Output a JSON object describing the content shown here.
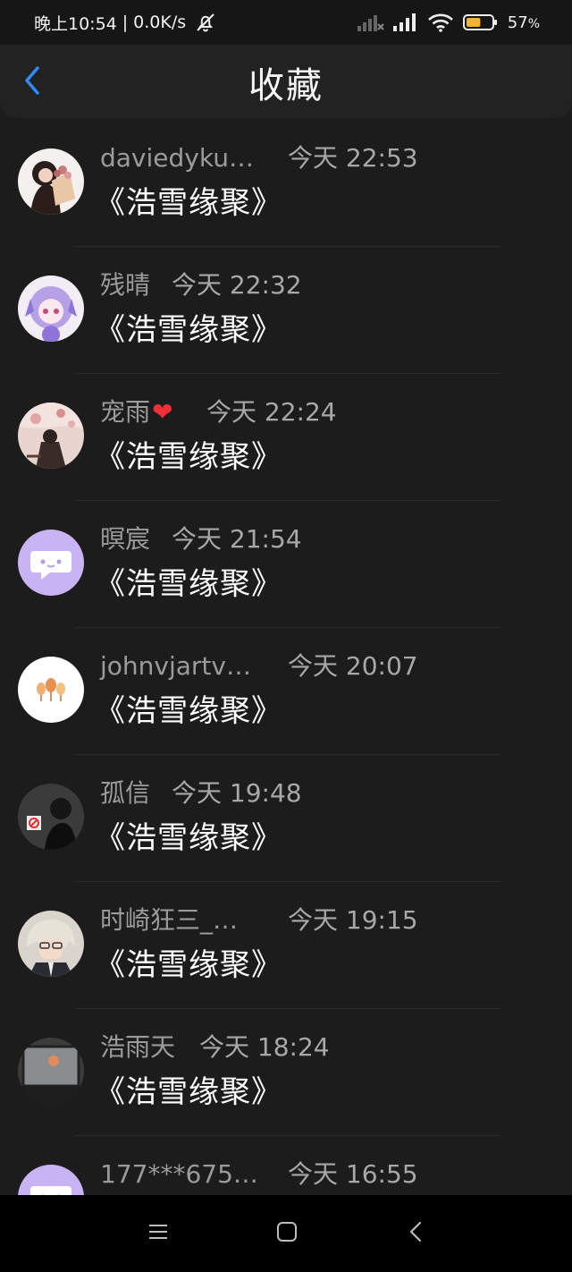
{
  "status_bar": {
    "time": "晚上10:54",
    "separator": "|",
    "net_speed": "0.0K/s",
    "battery_percent": "57",
    "battery_unit": "%",
    "battery_level": 0.57,
    "icons": [
      "bell-off-icon",
      "signal-weak-icon",
      "signal-icon",
      "wifi-icon",
      "battery-icon"
    ]
  },
  "header": {
    "title": "收藏",
    "back_icon": "chevron-left-icon",
    "accent_color": "#2f8bff"
  },
  "favorites": [
    {
      "user": "daviedyku…",
      "time": "今天 22:53",
      "title": "《浩雪缘聚》",
      "avatar": "girl-with-flowers"
    },
    {
      "user": "残晴",
      "time": "今天 22:32",
      "title": "《浩雪缘聚》",
      "avatar": "anime-purple-hair"
    },
    {
      "user": "宠雨",
      "badge": "❤",
      "time": "今天 22:24",
      "title": "《浩雪缘聚》",
      "avatar": "blossom-photo"
    },
    {
      "user": "暝宸",
      "time": "今天 21:54",
      "title": "《浩雪缘聚》",
      "avatar": "default-chat-bubble"
    },
    {
      "user": "johnvjartv…",
      "time": "今天 20:07",
      "title": "《浩雪缘聚》",
      "avatar": "autumn-leaves"
    },
    {
      "user": "孤信",
      "time": "今天 19:48",
      "title": "《浩雪缘聚》",
      "avatar": "dark-portrait"
    },
    {
      "user": "时崎狂三_…",
      "time": "今天 19:15",
      "title": "《浩雪缘聚》",
      "avatar": "anime-glasses"
    },
    {
      "user": "浩雨天",
      "time": "今天 18:24",
      "title": "《浩雪缘聚》",
      "avatar": "window-photo"
    },
    {
      "user": "177***675…",
      "time": "今天 16:55",
      "title": "",
      "avatar": "default-chat-bubble"
    }
  ],
  "nav_bar": {
    "icons": [
      "menu-icon",
      "home-square-icon",
      "back-triangle-icon"
    ]
  }
}
